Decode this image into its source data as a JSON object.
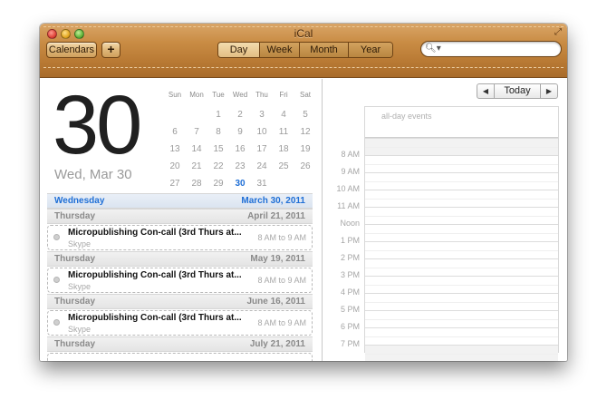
{
  "window": {
    "title": "iCal"
  },
  "toolbar": {
    "calendars_label": "Calendars",
    "add_label": "+",
    "views": [
      {
        "label": "Day",
        "active": true
      },
      {
        "label": "Week",
        "active": false
      },
      {
        "label": "Month",
        "active": false
      },
      {
        "label": "Year",
        "active": false
      }
    ],
    "search": {
      "value": "",
      "placeholder": ""
    }
  },
  "date": {
    "day_number": "30",
    "caption": "Wed, Mar 30"
  },
  "mini_calendar": {
    "weekdays": [
      "Sun",
      "Mon",
      "Tue",
      "Wed",
      "Thu",
      "Fri",
      "Sat"
    ],
    "weeks": [
      [
        "",
        "",
        "1",
        "2",
        "3",
        "4",
        "5"
      ],
      [
        "6",
        "7",
        "8",
        "9",
        "10",
        "11",
        "12"
      ],
      [
        "13",
        "14",
        "15",
        "16",
        "17",
        "18",
        "19"
      ],
      [
        "20",
        "21",
        "22",
        "23",
        "24",
        "25",
        "26"
      ],
      [
        "27",
        "28",
        "29",
        "30",
        "31",
        "",
        ""
      ]
    ],
    "today": "30"
  },
  "agenda": [
    {
      "type": "header",
      "day": "Wednesday",
      "date": "March 30, 2011",
      "current": true
    },
    {
      "type": "header",
      "day": "Thursday",
      "date": "April 21, 2011"
    },
    {
      "type": "event",
      "title": "Micropublishing Con-call (3rd Thurs at...",
      "calendar": "Skype",
      "time": "8 AM to 9 AM"
    },
    {
      "type": "header",
      "day": "Thursday",
      "date": "May 19, 2011"
    },
    {
      "type": "event",
      "title": "Micropublishing Con-call (3rd Thurs at...",
      "calendar": "Skype",
      "time": "8 AM to 9 AM"
    },
    {
      "type": "header",
      "day": "Thursday",
      "date": "June 16, 2011"
    },
    {
      "type": "event",
      "title": "Micropublishing Con-call (3rd Thurs at...",
      "calendar": "Skype",
      "time": "8 AM to 9 AM"
    },
    {
      "type": "header",
      "day": "Thursday",
      "date": "July 21, 2011"
    },
    {
      "type": "event",
      "title": "",
      "calendar": "",
      "time": ""
    }
  ],
  "day_view": {
    "nav": {
      "prev": "◀",
      "today": "Today",
      "next": "▶"
    },
    "all_day_label": "all-day events",
    "hours": [
      {
        "label": "",
        "off": true
      },
      {
        "label": "8 AM",
        "off": false
      },
      {
        "label": "9 AM",
        "off": false
      },
      {
        "label": "10 AM",
        "off": false
      },
      {
        "label": "11 AM",
        "off": false
      },
      {
        "label": "Noon",
        "off": false
      },
      {
        "label": "1 PM",
        "off": false
      },
      {
        "label": "2 PM",
        "off": false
      },
      {
        "label": "3 PM",
        "off": false
      },
      {
        "label": "4 PM",
        "off": false
      },
      {
        "label": "5 PM",
        "off": false
      },
      {
        "label": "6 PM",
        "off": false
      },
      {
        "label": "7 PM",
        "off": true
      }
    ]
  },
  "colors": {
    "accent": "#1f6fd6",
    "leather": "#c98c44"
  }
}
